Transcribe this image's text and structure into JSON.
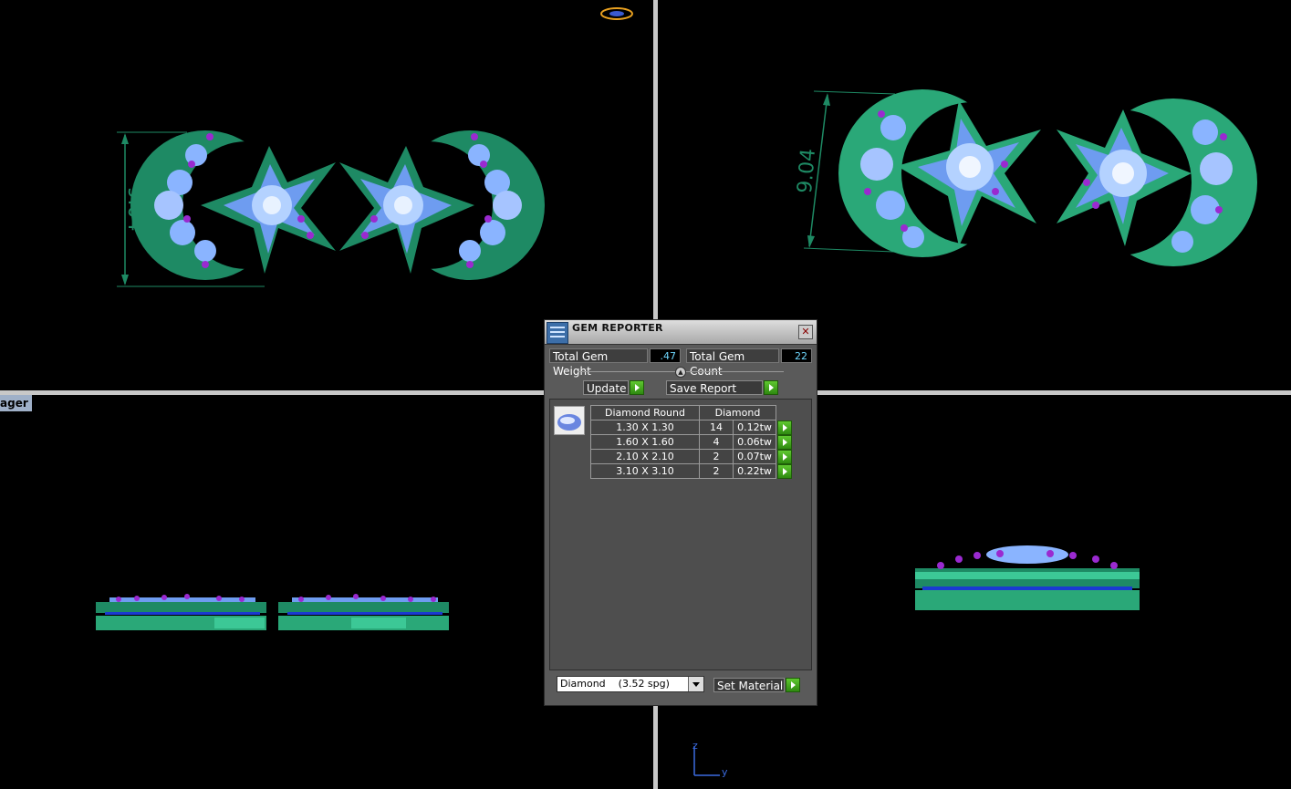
{
  "viewport_label": "ager",
  "dimension": "9.04",
  "gem_reporter": {
    "title": "GEM REPORTER",
    "close_glyph": "✕",
    "total_weight_label": "Total Gem Weight",
    "total_weight_value": ".47",
    "total_count_label": "Total Gem Count",
    "total_count_value": "22",
    "update_label": "Update",
    "save_report_label": "Save Report",
    "table": {
      "headers": [
        "Diamond Round",
        "Diamond"
      ],
      "rows": [
        {
          "size": "1.30 X 1.30",
          "count": "14",
          "weight": "0.12tw"
        },
        {
          "size": "1.60 X 1.60",
          "count": "4",
          "weight": "0.06tw"
        },
        {
          "size": "2.10 X 2.10",
          "count": "2",
          "weight": "0.07tw"
        },
        {
          "size": "3.10 X 3.10",
          "count": "2",
          "weight": "0.22tw"
        }
      ]
    },
    "material_select": "Diamond    (3.52 spg)",
    "set_material_label": "Set Material"
  },
  "axes": {
    "z": "z",
    "y": "y"
  },
  "colors": {
    "metal": "#1e8a64",
    "metal_light": "#3cc896",
    "gem": "#8ab4ff",
    "accent_gem": "#9a2ad0",
    "value_text": "#6fd8ff"
  }
}
